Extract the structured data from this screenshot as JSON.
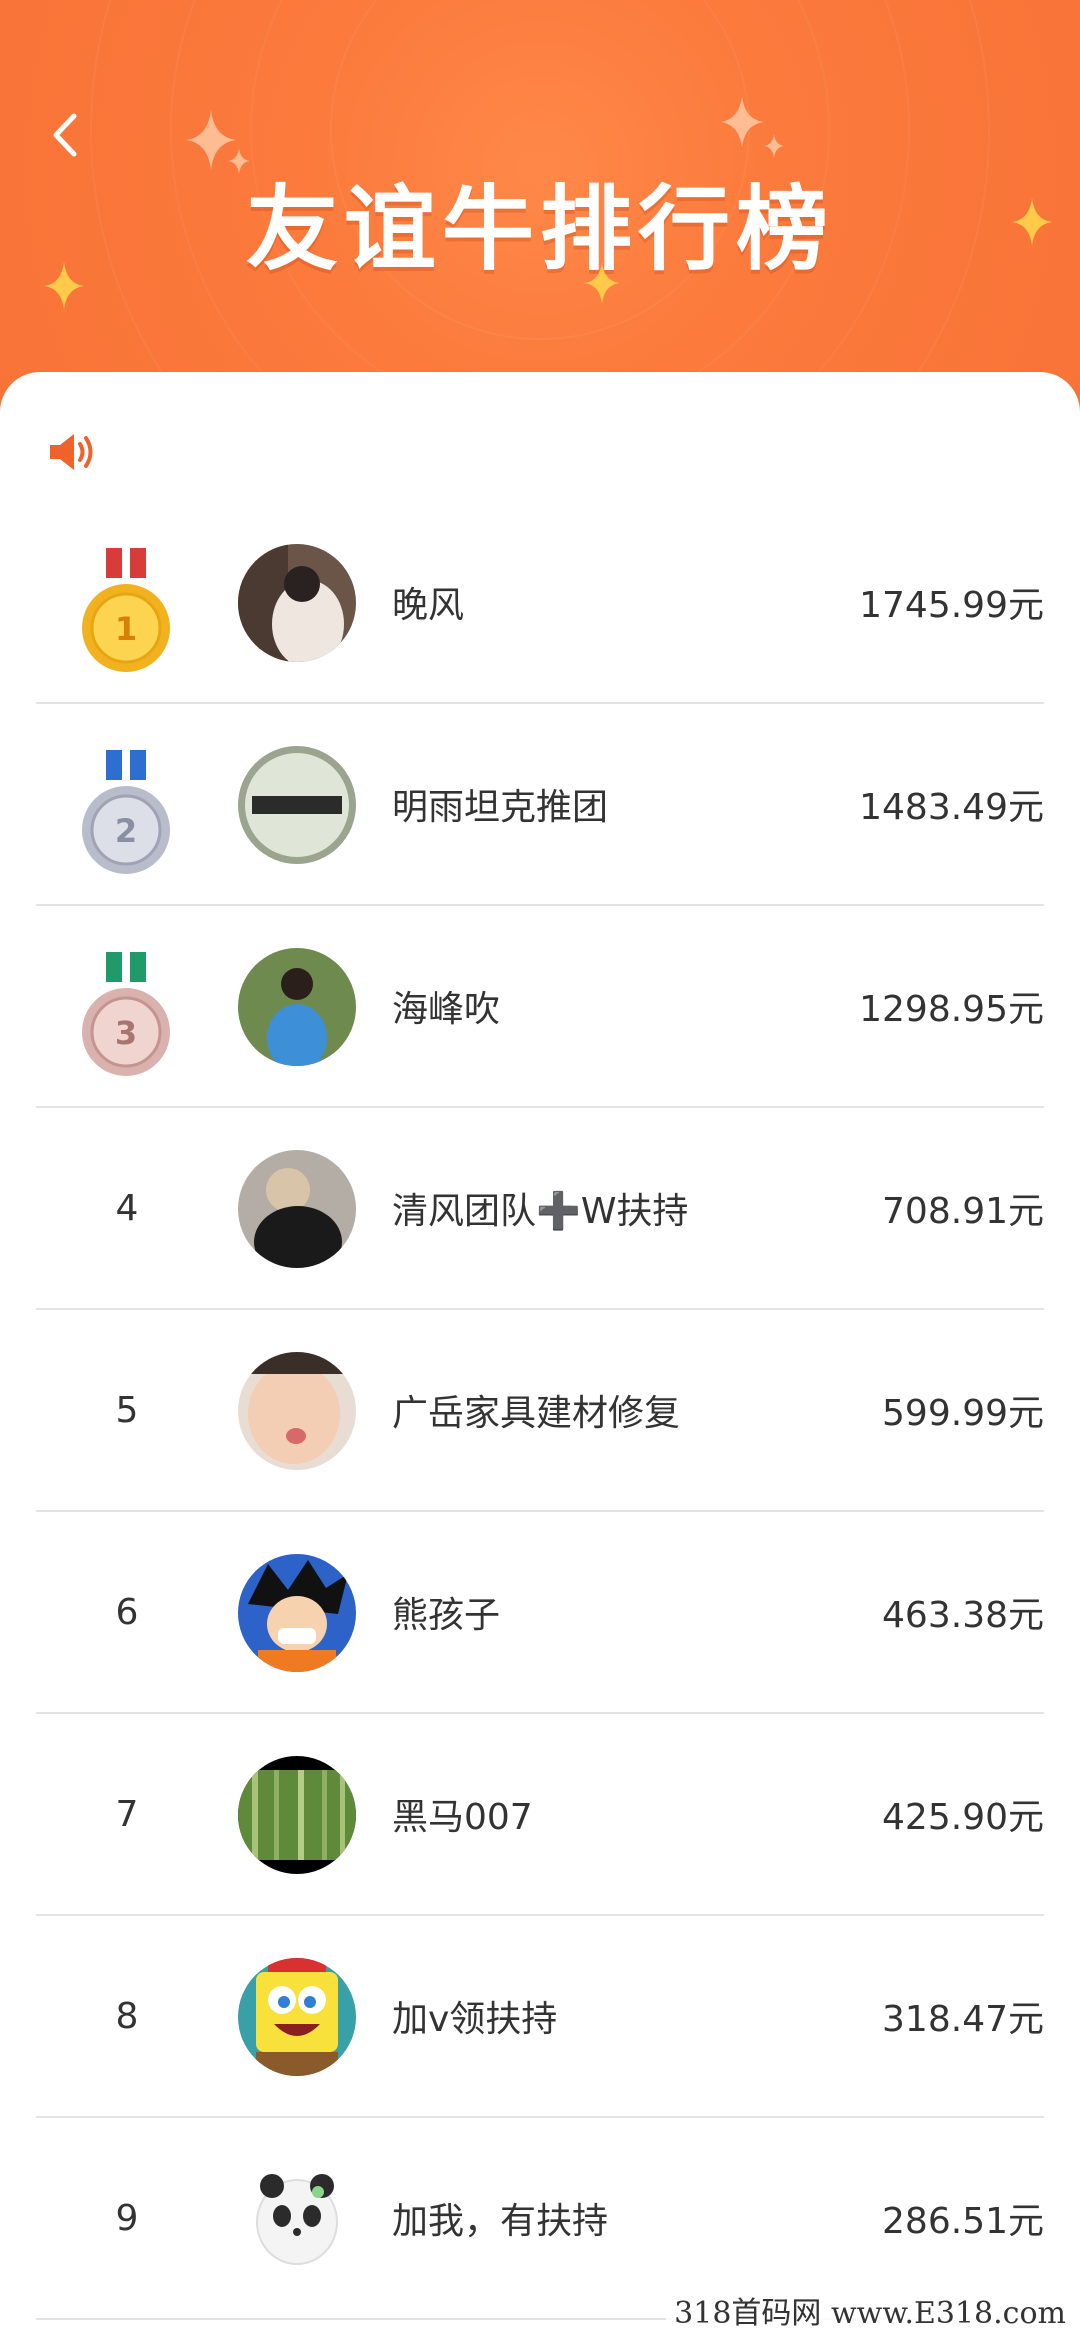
{
  "header": {
    "title": "友谊牛排行榜",
    "back_icon": "chevron-left-icon",
    "background_color": "#f87337"
  },
  "notice": {
    "icon": "speaker-icon",
    "color": "#f0622c"
  },
  "leaderboard": [
    {
      "rank": "1",
      "medal": "gold-medal",
      "name": "晚风",
      "amount": "1745.99元"
    },
    {
      "rank": "2",
      "medal": "silver-medal",
      "name": "明雨坦克推团",
      "amount": "1483.49元"
    },
    {
      "rank": "3",
      "medal": "bronze-medal",
      "name": "海峰吹",
      "amount": "1298.95元"
    },
    {
      "rank": "4",
      "name": "清风团队➕W扶持",
      "amount": "708.91元"
    },
    {
      "rank": "5",
      "name": "广岳家具建材修复",
      "amount": "599.99元"
    },
    {
      "rank": "6",
      "name": "熊孩子",
      "amount": "463.38元"
    },
    {
      "rank": "7",
      "name": "黑马007",
      "amount": "425.90元"
    },
    {
      "rank": "8",
      "name": "加v领扶持",
      "amount": "318.47元"
    },
    {
      "rank": "9",
      "name": "加我，有扶持",
      "amount": "286.51元"
    }
  ],
  "watermark": "318首码网 www.E318.com"
}
